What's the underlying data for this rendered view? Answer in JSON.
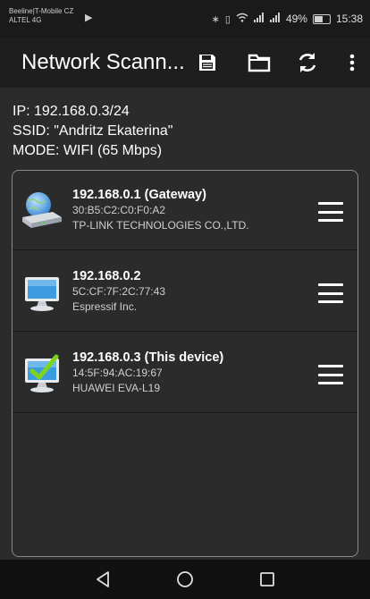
{
  "status_bar": {
    "carrier_line1": "Beeline|T-Mobile CZ",
    "carrier_line2": "ALTEL 4G",
    "battery_percent": "49%",
    "time": "15:38"
  },
  "app_bar": {
    "title": "Network Scann..."
  },
  "info": {
    "ip": "IP: 192.168.0.3/24",
    "ssid": "SSID: \"Andritz Ekaterina\"",
    "mode": "MODE: WIFI (65 Mbps)"
  },
  "devices": [
    {
      "name": "192.168.0.1 (Gateway)",
      "mac": "30:B5:C2:C0:F0:A2",
      "vendor": "TP-LINK TECHNOLOGIES CO.,LTD.",
      "icon": "router-icon"
    },
    {
      "name": "192.168.0.2",
      "mac": "5C:CF:7F:2C:77:43",
      "vendor": "Espressif Inc.",
      "icon": "computer-icon"
    },
    {
      "name": "192.168.0.3 (This device)",
      "mac": "14:5F:94:AC:19:67",
      "vendor": "HUAWEI EVA-L19",
      "icon": "this-device-icon"
    }
  ],
  "colors": {
    "background": "#2b2b2b",
    "app_bar": "#1e1e1e",
    "panel_border": "#8a8a8a",
    "text": "#ffffff"
  }
}
